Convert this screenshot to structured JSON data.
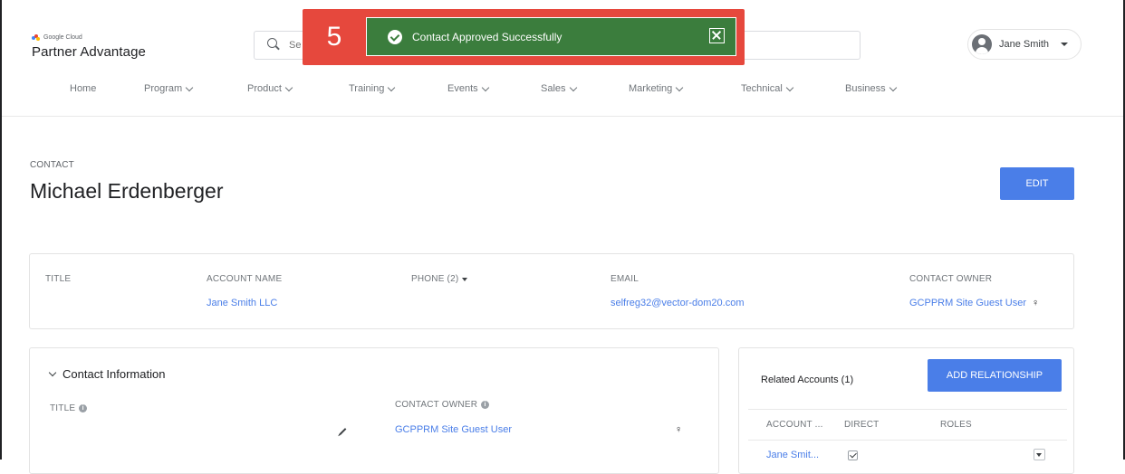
{
  "brand": {
    "small_label": "Google Cloud",
    "name": "Partner Advantage"
  },
  "search": {
    "placeholder": "Se"
  },
  "user": {
    "name": "Jane Smith"
  },
  "nav": {
    "items": [
      {
        "label": "Home"
      },
      {
        "label": "Program"
      },
      {
        "label": "Product"
      },
      {
        "label": "Training"
      },
      {
        "label": "Events"
      },
      {
        "label": "Sales"
      },
      {
        "label": "Marketing"
      },
      {
        "label": "Technical"
      },
      {
        "label": "Business"
      }
    ]
  },
  "step": {
    "number": "5"
  },
  "toast": {
    "message": "Contact Approved Successfully"
  },
  "record": {
    "object_label": "CONTACT",
    "name": "Michael Erdenberger",
    "edit_label": "EDIT"
  },
  "highlights": {
    "title_label": "TITLE",
    "title_value": "",
    "account_label": "ACCOUNT NAME",
    "account_value": "Jane Smith LLC",
    "phone_label": "PHONE (2)",
    "email_label": "EMAIL",
    "email_value": "selfreg32@vector-dom20.com",
    "owner_label": "CONTACT OWNER",
    "owner_value": "GCPPRM Site Guest User"
  },
  "contact_info": {
    "section_title": "Contact Information",
    "title_label": "TITLE",
    "owner_label": "CONTACT OWNER",
    "owner_value": "GCPPRM Site Guest User"
  },
  "related": {
    "title": "Related Accounts (1)",
    "add_label": "ADD RELATIONSHIP",
    "columns": [
      "ACCOUNT ...",
      "DIRECT",
      "ROLES"
    ],
    "rows": [
      {
        "account": "Jane Smit...",
        "direct": true,
        "roles": ""
      }
    ]
  },
  "colors": {
    "accent": "#4a7ee8",
    "toast_success": "#3b7d3d",
    "step_badge": "#e6483d"
  },
  "icons": [
    "search-icon",
    "avatar-icon",
    "chevron-down-icon",
    "check-circle-icon",
    "close-icon",
    "pencil-icon",
    "change-owner-icon",
    "info-icon"
  ]
}
